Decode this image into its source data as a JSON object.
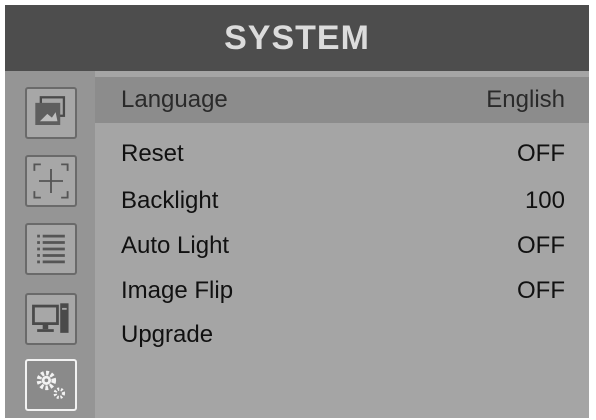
{
  "header": {
    "title": "SYSTEM"
  },
  "sidebar": {
    "icons": [
      "picture-icon",
      "crosshair-icon",
      "list-icon",
      "computer-icon",
      "settings-gears-icon"
    ],
    "selected": "settings-gears-icon"
  },
  "menu": {
    "items": [
      {
        "label": "Language",
        "value": "English",
        "highlighted": true
      },
      {
        "label": "Reset",
        "value": "OFF"
      },
      {
        "label": "Backlight",
        "value": "100"
      },
      {
        "label": "Auto Light",
        "value": "OFF"
      },
      {
        "label": "Image Flip",
        "value": "OFF"
      },
      {
        "label": "Upgrade",
        "value": ""
      }
    ]
  },
  "colors": {
    "header_bg": "#4d4d4d",
    "panel_bg": "#a5a5a5",
    "sidebar_bg": "#959595",
    "highlight_row": "#8c8c8c",
    "title_text": "#dcdcdc"
  }
}
